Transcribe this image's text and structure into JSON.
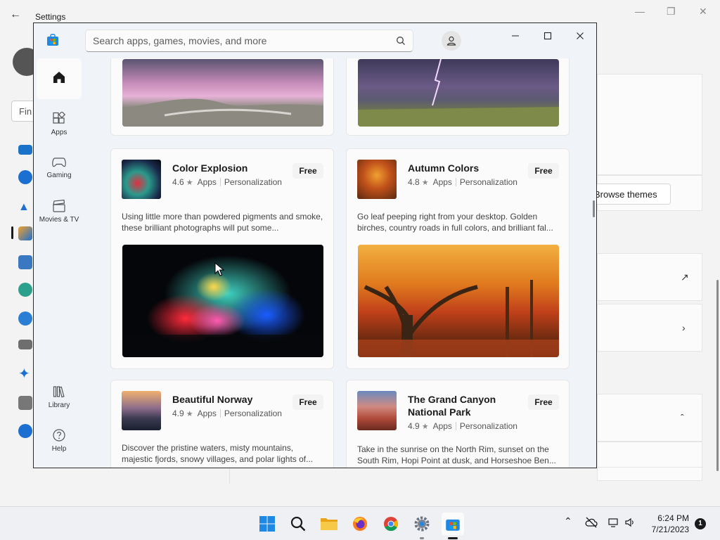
{
  "settings": {
    "title": "Settings",
    "search_partial": "Fin",
    "browse_themes": "Browse themes"
  },
  "store": {
    "search_placeholder": "Search apps, games, movies, and more",
    "nav": [
      {
        "label": ""
      },
      {
        "label": "Apps"
      },
      {
        "label": "Gaming"
      },
      {
        "label": "Movies & TV"
      },
      {
        "label": "Library"
      },
      {
        "label": "Help"
      }
    ],
    "apps": [
      {
        "name": "Color Explosion",
        "rating": "4.6",
        "category": "Apps",
        "subcategory": "Personalization",
        "price": "Free",
        "description": "Using little more than powdered pigments and smoke, these brilliant photographs will put some..."
      },
      {
        "name": "Autumn Colors",
        "rating": "4.8",
        "category": "Apps",
        "subcategory": "Personalization",
        "price": "Free",
        "description": "Go leaf peeping right from your desktop. Golden birches, country roads in full colors, and brilliant fal..."
      },
      {
        "name": "Beautiful Norway",
        "rating": "4.9",
        "category": "Apps",
        "subcategory": "Personalization",
        "price": "Free",
        "description": "Discover the pristine waters, misty mountains, majestic fjords, snowy villages, and polar lights of..."
      },
      {
        "name": "The Grand Canyon National Park",
        "rating": "4.9",
        "category": "Apps",
        "subcategory": "Personalization",
        "price": "Free",
        "description": "Take in the sunrise on the North Rim, sunset on the South Rim, Hopi Point at dusk, and Horseshoe Ben..."
      }
    ]
  },
  "taskbar": {
    "time": "6:24 PM",
    "date": "7/21/2023",
    "notifications": "1"
  },
  "colors": {
    "accent": "#0067c0",
    "store_bg": "#f0f3f8",
    "card_bg": "#fbfbfb"
  }
}
